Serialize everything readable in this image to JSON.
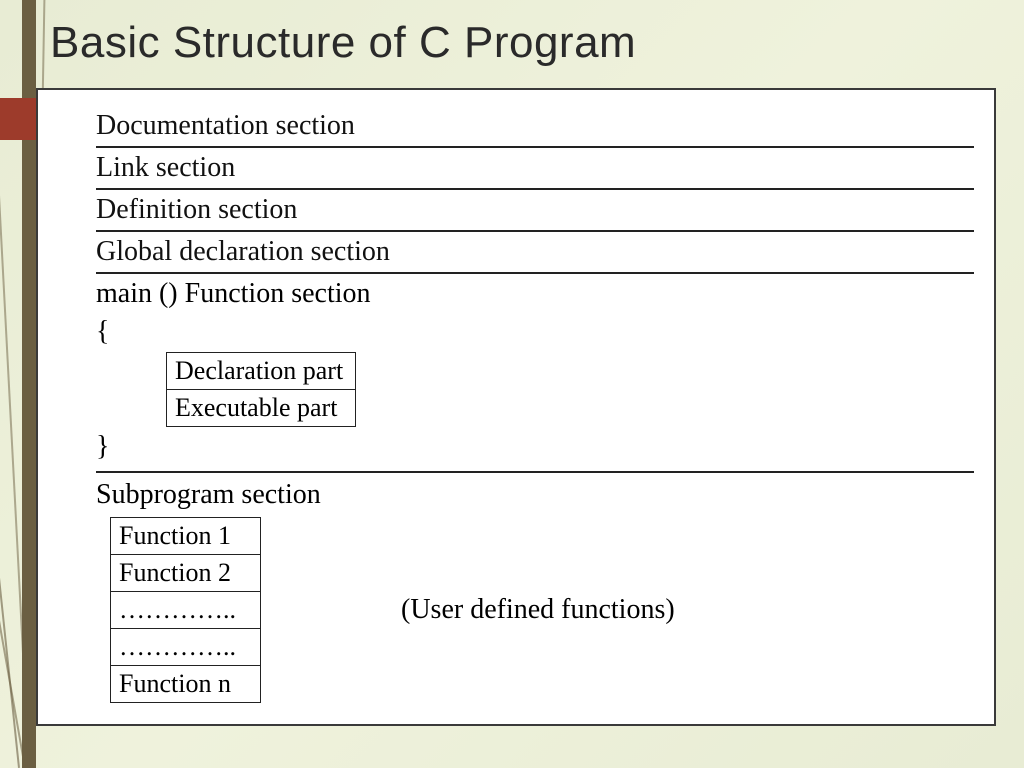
{
  "title": "Basic Structure of C Program",
  "sections": {
    "documentation": "Documentation section",
    "link": "Link section",
    "definition": "Definition section",
    "global": "Global declaration section",
    "main_label": "main () Function section",
    "open_brace": "{",
    "close_brace": "}",
    "main_parts": {
      "declaration": "Declaration part",
      "executable": "Executable part"
    },
    "subprogram_label": "Subprogram section",
    "functions": {
      "f1": "Function 1",
      "f2": "Function 2",
      "dots1": "…………..",
      "dots2": "…………..",
      "fn": "Function n"
    },
    "user_defined": "(User defined functions)"
  }
}
